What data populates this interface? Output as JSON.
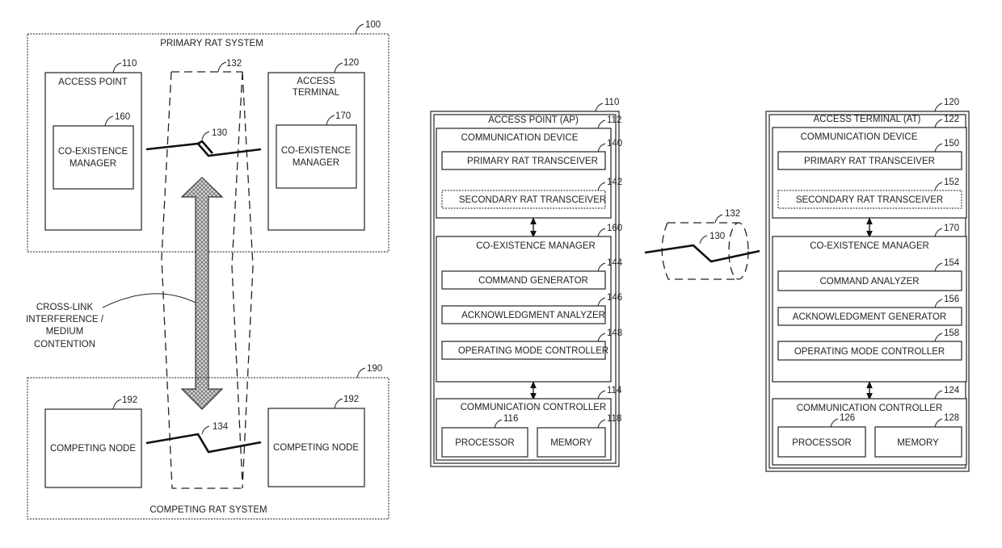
{
  "figure_left": {
    "primary_system": {
      "label": "PRIMARY RAT SYSTEM",
      "ref": "100"
    },
    "access_point": {
      "label_lines": [
        "ACCESS POINT"
      ],
      "ref": "110",
      "coexistence": {
        "label_lines": [
          "CO-EXISTENCE",
          "MANAGER"
        ],
        "ref": "160"
      }
    },
    "access_terminal": {
      "label_lines": [
        "ACCESS",
        "TERMINAL"
      ],
      "ref": "120",
      "coexistence": {
        "label_lines": [
          "CO-EXISTENCE",
          "MANAGER"
        ],
        "ref": "170"
      }
    },
    "link_primary_ref": "130",
    "medium_ref": "132",
    "link_competing_ref": "134",
    "interference_label_lines": [
      "CROSS-LINK",
      "INTERFERENCE /",
      "MEDIUM",
      "CONTENTION"
    ],
    "competing_system": {
      "label": "COMPETING RAT SYSTEM",
      "ref": "190"
    },
    "competing_nodes": [
      {
        "label": "COMPETING NODE",
        "ref": "192"
      },
      {
        "label": "COMPETING NODE",
        "ref": "192"
      }
    ]
  },
  "figure_right": {
    "access_point": {
      "title": "ACCESS POINT (AP)",
      "ref": "110",
      "comm_device": {
        "title": "COMMUNICATION DEVICE",
        "ref": "112",
        "items": [
          {
            "label": "PRIMARY RAT TRANSCEIVER",
            "ref": "140",
            "style": "solid"
          },
          {
            "label": "SECONDARY RAT TRANSCEIVER",
            "ref": "142",
            "style": "dotted"
          }
        ]
      },
      "coexistence": {
        "title": "CO-EXISTENCE MANAGER",
        "ref": "160",
        "items": [
          {
            "label": "COMMAND GENERATOR",
            "ref": "144"
          },
          {
            "label": "ACKNOWLEDGMENT ANALYZER",
            "ref": "146"
          },
          {
            "label": "OPERATING MODE CONTROLLER",
            "ref": "148"
          }
        ]
      },
      "controller": {
        "title": "COMMUNICATION CONTROLLER",
        "ref": "114",
        "processor": {
          "label": "PROCESSOR",
          "ref": "116"
        },
        "memory": {
          "label": "MEMORY",
          "ref": "118"
        }
      }
    },
    "link_ref": "130",
    "medium_ref": "132",
    "access_terminal": {
      "title": "ACCESS TERMINAL (AT)",
      "ref": "120",
      "comm_device": {
        "title": "COMMUNICATION DEVICE",
        "ref": "122",
        "items": [
          {
            "label": "PRIMARY RAT TRANSCEIVER",
            "ref": "150",
            "style": "solid"
          },
          {
            "label": "SECONDARY RAT TRANSCEIVER",
            "ref": "152",
            "style": "dotted"
          }
        ]
      },
      "coexistence": {
        "title": "CO-EXISTENCE MANAGER",
        "ref": "170",
        "items": [
          {
            "label": "COMMAND ANALYZER",
            "ref": "154"
          },
          {
            "label": "ACKNOWLEDGMENT GENERATOR",
            "ref": "156"
          },
          {
            "label": "OPERATING MODE CONTROLLER",
            "ref": "158"
          }
        ]
      },
      "controller": {
        "title": "COMMUNICATION CONTROLLER",
        "ref": "124",
        "processor": {
          "label": "PROCESSOR",
          "ref": "126"
        },
        "memory": {
          "label": "MEMORY",
          "ref": "128"
        }
      }
    }
  }
}
